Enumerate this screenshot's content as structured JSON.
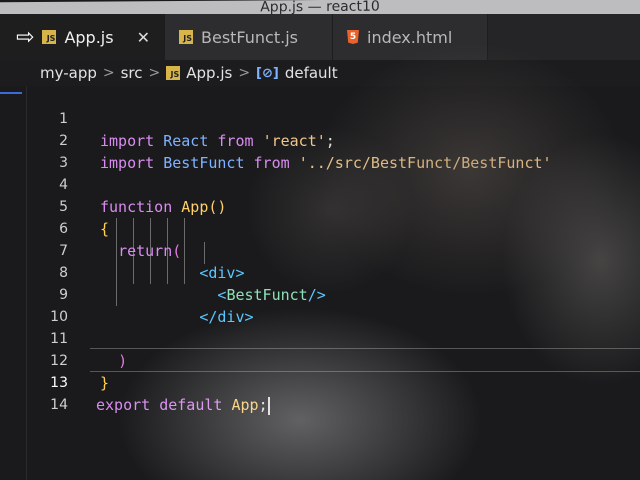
{
  "window": {
    "title": "App.js — react10"
  },
  "tabs": [
    {
      "label": "App.js",
      "icon": "js-file-icon",
      "active": true
    },
    {
      "label": "BestFunct.js",
      "icon": "js-file-icon",
      "active": false
    },
    {
      "label": "index.html",
      "icon": "html-file-icon",
      "active": false
    }
  ],
  "breadcrumb": [
    "my-app",
    "src",
    "App.js",
    "default"
  ],
  "editor": {
    "line_numbers": [
      "1",
      "2",
      "3",
      "4",
      "5",
      "6",
      "7",
      "8",
      "9",
      "10",
      "11",
      "12",
      "13",
      "14"
    ],
    "current_line": "13",
    "tokens": {
      "l1_kw": "import",
      "l1_id": "React",
      "l1_from": "from",
      "l1_str": "'react'",
      "l1_semi": ";",
      "l2_kw": "import",
      "l2_id": "BestFunct",
      "l2_from": "from",
      "l2_str": "'../src/BestFunct/BestFunct'",
      "l4_kw": "function",
      "l4_fn": "App",
      "l4_parens": "()",
      "l5_brace": "{",
      "l6_kw": "return",
      "l6_paren": "(",
      "l7_lt": "<",
      "l7_tag": "div",
      "l7_gt": ">",
      "l8_lt": "<",
      "l8_tag": "BestFunct",
      "l8_close": "/>",
      "l9_lt": "</",
      "l9_tag": "div",
      "l9_gt": ">",
      "l11_paren": ")",
      "l12_brace": "}",
      "l13_export": "export",
      "l13_default": "default",
      "l13_app": "App",
      "l13_semi": ";"
    }
  },
  "colors": {
    "keyword": "#d98cf0",
    "identifier": "#7fb2ff",
    "string": "#f2c88a",
    "function": "#ffcf6a",
    "tag": "#59c7ff",
    "component": "#8de0b8"
  }
}
